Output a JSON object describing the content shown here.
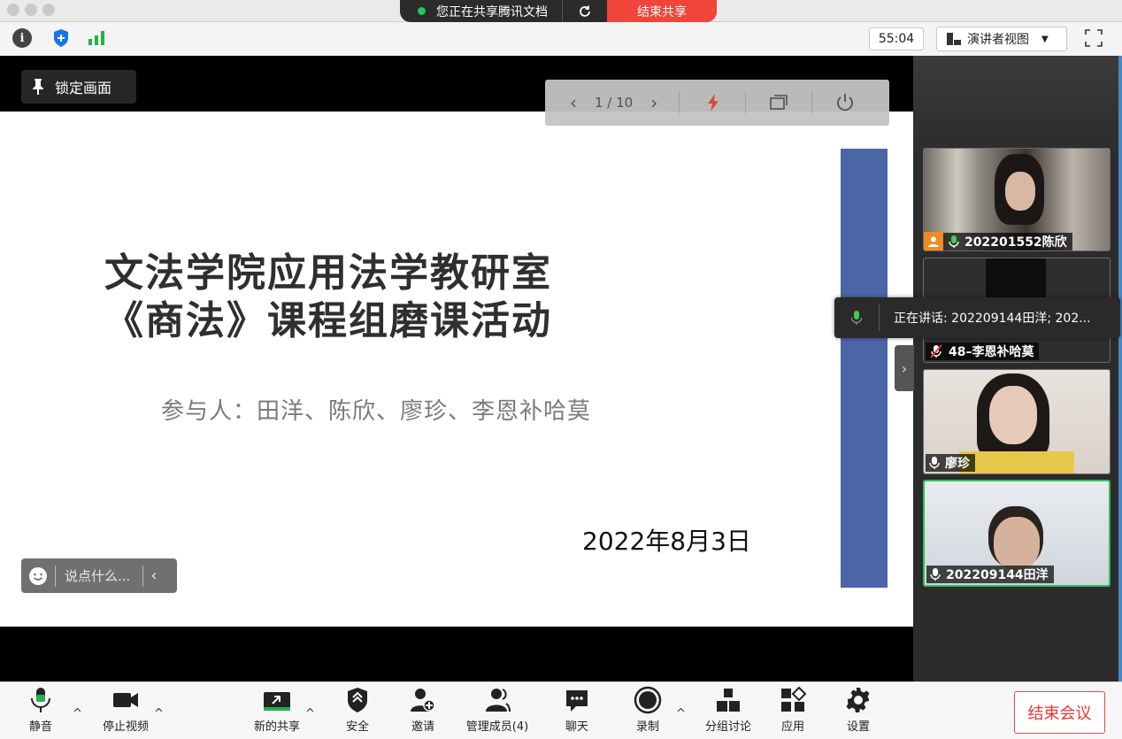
{
  "share_bar": {
    "status_text": "您正在共享腾讯文档",
    "end_share_label": "结束共享"
  },
  "toolbar": {
    "timer": "55:04",
    "view_label": "演讲者视图"
  },
  "stage": {
    "lock_label": "锁定画面",
    "page_indicator": "1 / 10",
    "chat_placeholder": "说点什么..."
  },
  "slide": {
    "title_line1": "文法学院应用法学教研室",
    "title_line2": "《商法》课程组磨课活动",
    "participants": "参与人：田洋、陈欣、廖珍、李恩补哈莫",
    "date": "2022年8月3日"
  },
  "speaking_banner": "正在讲话: 202209144田洋; 202...",
  "participants_panel": [
    {
      "name": "202201552陈欣",
      "host": true,
      "mic": "on"
    },
    {
      "name": "48–李恩补哈莫",
      "host": false,
      "mic": "muted"
    },
    {
      "name": "廖珍",
      "host": false,
      "mic": "on"
    },
    {
      "name": "202209144田洋",
      "host": false,
      "mic": "on",
      "active": true
    }
  ],
  "bottom_bar": {
    "mute": "静音",
    "stop_video": "停止视频",
    "new_share": "新的共享",
    "security": "安全",
    "invite": "邀请",
    "manage_members": "管理成员(4)",
    "chat": "聊天",
    "record": "录制",
    "breakout": "分组讨论",
    "apps": "应用",
    "settings": "设置",
    "end_meeting": "结束会议"
  },
  "colors": {
    "end_red": "#f0453a",
    "slide_bar_blue": "#4b65a6",
    "active_speaker_green": "#2fbf5b"
  }
}
